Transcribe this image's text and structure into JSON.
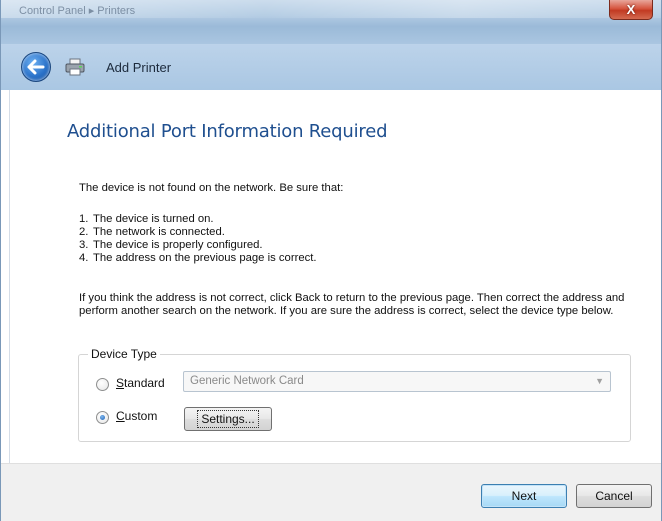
{
  "window": {
    "title": "Control Panel  ▸  Printers",
    "close_label": "X"
  },
  "nav": {
    "title": "Add Printer",
    "back_icon": "back-arrow-icon",
    "printer_icon": "printer-icon"
  },
  "page": {
    "heading": "Additional Port Information Required",
    "intro": "The device is not found on the network.  Be sure that:",
    "steps": [
      {
        "num": "1.",
        "text": "The device is turned on."
      },
      {
        "num": "2.",
        "text": "The network is connected."
      },
      {
        "num": "3.",
        "text": "The device is properly configured."
      },
      {
        "num": "4.",
        "text": "The address on the previous page is correct."
      }
    ],
    "paragraph": "If you think the address is not correct, click Back to return to the previous page.  Then correct the address and perform another search on the network.  If you are sure the address is correct, select the device type below."
  },
  "device_type": {
    "legend": "Device Type",
    "standard": {
      "label_first": "S",
      "label_rest": "tandard",
      "checked": false
    },
    "custom": {
      "label_first": "C",
      "label_rest": "ustom",
      "checked": true
    },
    "select_value": "Generic Network Card",
    "settings_button": "Settings..."
  },
  "footer": {
    "next_label": "Next",
    "cancel_label": "Cancel"
  },
  "colors": {
    "heading": "#1f4f8f",
    "accent": "#3c7fb1"
  }
}
